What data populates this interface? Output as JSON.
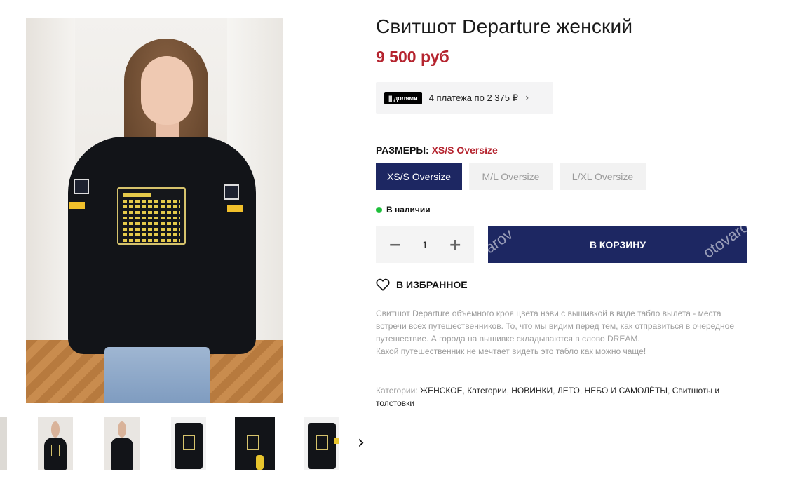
{
  "product": {
    "title": "Свитшот Departure женский",
    "price": "9 500 руб"
  },
  "installments": {
    "logo_text": "долями",
    "text": "4 платежа по 2 375 ₽"
  },
  "sizes": {
    "label": "РАЗМЕРЫ:",
    "selected": "XS/S Oversize",
    "options": [
      "XS/S Oversize",
      "M/L Oversize",
      "L/XL Oversize"
    ]
  },
  "stock": {
    "text": "В наличии",
    "color": "#1dbf3a"
  },
  "quantity": {
    "value": "1",
    "minus": "−",
    "plus": "+"
  },
  "cart": {
    "label": "В КОРЗИНУ",
    "watermark_left": "arov",
    "watermark_right": "otovaro"
  },
  "favorites": {
    "label": "В ИЗБРАННОЕ",
    "icon": "heart-icon"
  },
  "description": {
    "paragraph1": "Свитшот Departure объемного кроя цвета нэви с вышивкой в виде табло вылета - места встречи всех путешественников. То, что мы видим перед тем, как отправиться в очередное путешествие. А города на вышивке складываются в слово DREAM.",
    "paragraph2": "Какой путешественник не мечтает видеть это табло как можно чаще!"
  },
  "categories": {
    "label": "Категории:",
    "items": [
      "ЖЕНСКОЕ",
      "Категории",
      "НОВИНКИ",
      "ЛЕТО",
      "НЕБО И САМОЛЁТЫ",
      "Свитшоты и толстовки"
    ]
  },
  "gallery": {
    "next_icon": "chevron-right-icon",
    "next_glyph": "›"
  },
  "colors": {
    "accent": "#1d2762",
    "price": "#b5242f"
  }
}
